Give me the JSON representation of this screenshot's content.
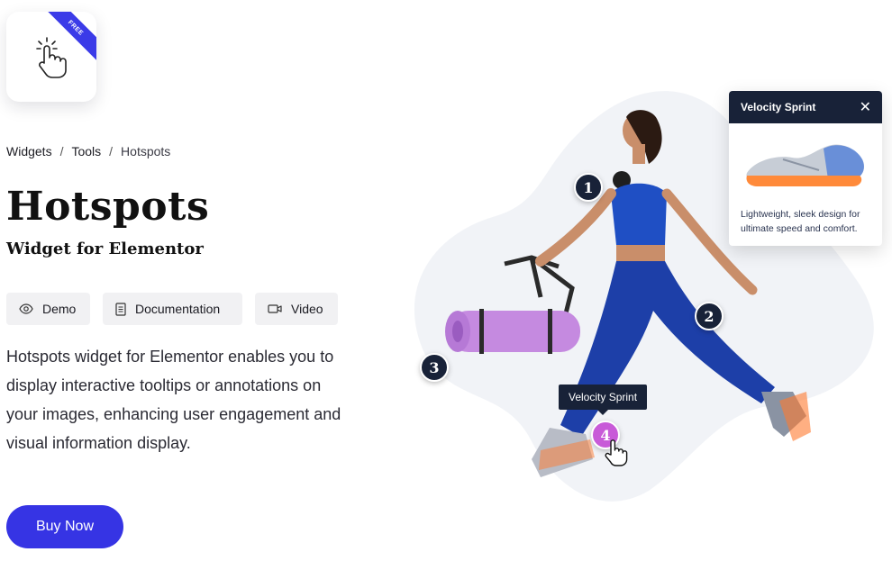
{
  "badge": {
    "label": "FREE",
    "color": "#3b3be8"
  },
  "breadcrumb": {
    "items": [
      {
        "label": "Widgets"
      },
      {
        "label": "Tools"
      },
      {
        "label": "Hotspots"
      }
    ],
    "separator": "/"
  },
  "header": {
    "title": "Hotspots",
    "subtitle": "Widget for Elementor"
  },
  "actions": {
    "demo_label": "Demo",
    "documentation_label": "Documentation",
    "video_label": "Video"
  },
  "description": "Hotspots widget for Elementor enables you to display interactive tooltips or annotations on your images, enhancing user engagement and visual information display.",
  "cta": {
    "label": "Buy Now",
    "color": "#3634e4"
  },
  "hero": {
    "hotspots": [
      {
        "number": "1"
      },
      {
        "number": "2"
      },
      {
        "number": "3"
      },
      {
        "number": "4"
      }
    ],
    "active_tooltip": "Velocity Sprint",
    "popup": {
      "title": "Velocity Sprint",
      "close_icon": "close-icon",
      "text": "Lightweight, sleek design for ultimate speed and comfort."
    }
  }
}
